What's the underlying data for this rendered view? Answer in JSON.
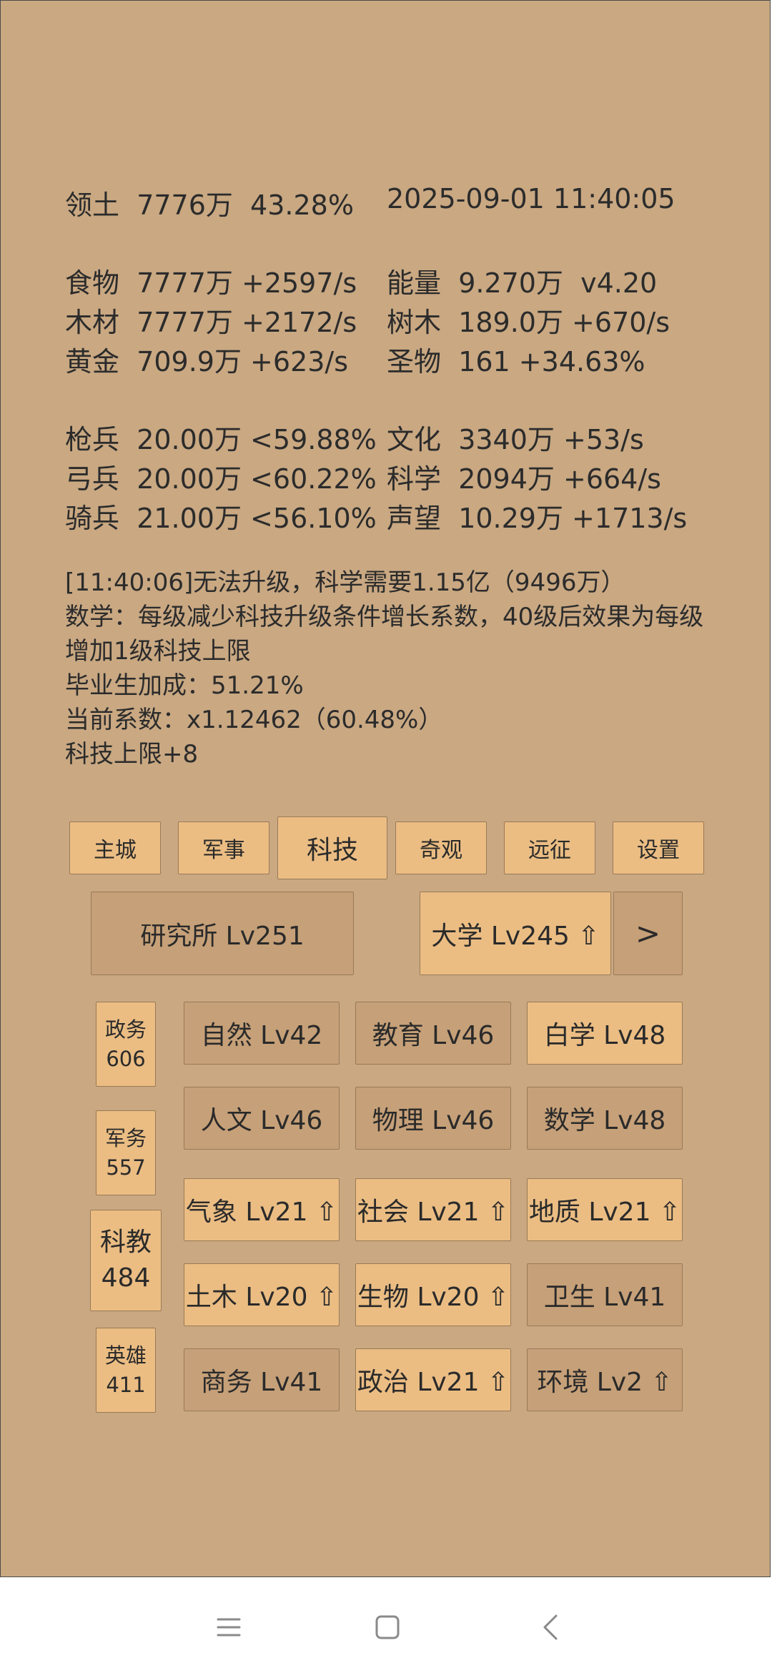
{
  "stats": {
    "territory": {
      "label": "领土",
      "value": "7776万  43.28%"
    },
    "datetime": "2025-09-01 11:40:05",
    "food": {
      "label": "食物",
      "value": "7777万 +2597/s"
    },
    "wood": {
      "label": "木材",
      "value": "7777万 +2172/s"
    },
    "gold": {
      "label": "黄金",
      "value": "709.9万 +623/s"
    },
    "energy": {
      "label": "能量",
      "value": "9.270万  v4.20"
    },
    "tree": {
      "label": "树木",
      "value": "189.0万 +670/s"
    },
    "relic": {
      "label": "圣物",
      "value": "161 +34.63%"
    },
    "spearman": {
      "label": "枪兵",
      "value": "20.00万 <59.88%"
    },
    "archer": {
      "label": "弓兵",
      "value": "20.00万 <60.22%"
    },
    "cavalry": {
      "label": "骑兵",
      "value": "21.00万 <56.10%"
    },
    "culture": {
      "label": "文化",
      "value": "3340万 +53/s"
    },
    "science": {
      "label": "科学",
      "value": "2094万 +664/s"
    },
    "prestige": {
      "label": "声望",
      "value": "10.29万 +1713/s"
    }
  },
  "log": {
    "line1": "[11:40:06]无法升级，科学需要1.15亿（9496万）",
    "line2": "数学：每级减少科技升级条件增长系数，40级后效果为每级增加1级科技上限",
    "line3": "毕业生加成：51.21%",
    "line4": "当前系数：x1.12462（60.48%）",
    "line5": "科技上限+8"
  },
  "tabs": {
    "main_city": "主城",
    "military": "军事",
    "tech": "科技",
    "wonders": "奇观",
    "expedition": "远征",
    "settings": "设置"
  },
  "buildings": {
    "institute": "研究所 Lv251",
    "university": "大学 Lv245 ⇧",
    "next": ">"
  },
  "categories": [
    {
      "name": "政务",
      "count": "606"
    },
    {
      "name": "军务",
      "count": "557"
    },
    {
      "name": "科教",
      "count": "484"
    },
    {
      "name": "英雄",
      "count": "411"
    }
  ],
  "techs": {
    "nature": "自然 Lv42",
    "education": "教育 Lv46",
    "self_study": "白学 Lv48",
    "humanities": "人文 Lv46",
    "physics": "物理 Lv46",
    "math": "数学 Lv48",
    "meteorology": "气象 Lv21 ⇧",
    "society": "社会 Lv21 ⇧",
    "geology": "地质 Lv21 ⇧",
    "civil": "土木 Lv20 ⇧",
    "biology": "生物 Lv20 ⇧",
    "health": "卫生 Lv41",
    "commerce": "商务 Lv41",
    "politics": "政治 Lv21 ⇧",
    "environment": "环境 Lv2 ⇧"
  },
  "colors": {
    "background": "#c9a882",
    "button_light": "#ebbd83",
    "button_dark": "#c6a078"
  },
  "nav": {
    "menu_icon": "menu-icon",
    "home_icon": "home-square-icon",
    "back_icon": "back-chevron-icon"
  }
}
